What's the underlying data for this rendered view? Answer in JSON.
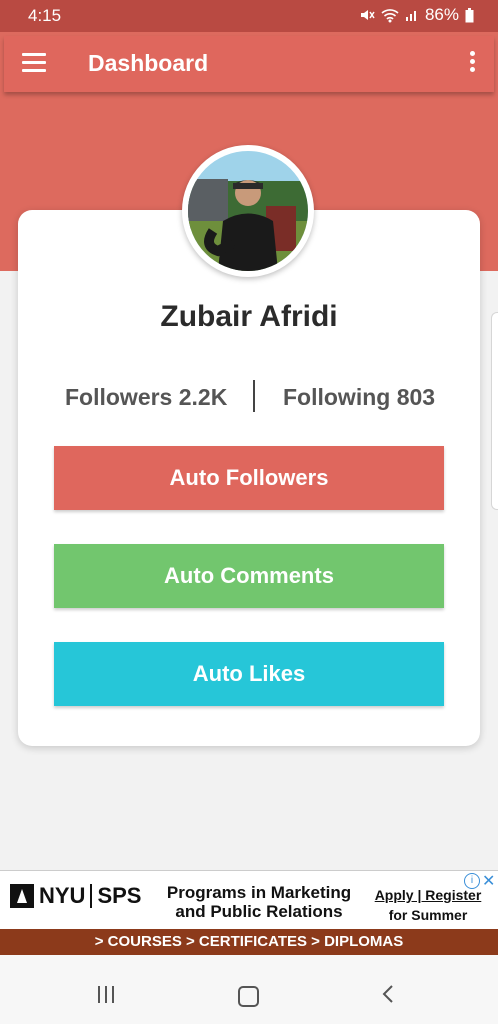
{
  "status_bar": {
    "time": "4:15",
    "battery": "86%"
  },
  "app_bar": {
    "title": "Dashboard",
    "menu_icon": "hamburger-menu-icon",
    "overflow_icon": "more-vert-icon"
  },
  "profile": {
    "name": "Zubair Afridi",
    "followers": "Followers 2.2K",
    "following": "Following 803"
  },
  "actions": [
    {
      "label": "Auto Followers",
      "color": "#df675d"
    },
    {
      "label": "Auto Comments",
      "color": "#72c66e"
    },
    {
      "label": "Auto Likes",
      "color": "#26c6d8"
    }
  ],
  "ad": {
    "brand_nyu": "NYU",
    "brand_sps": "SPS",
    "headline_line1": "Programs in Marketing",
    "headline_line2": "and Public Relations",
    "cta_line1": "Apply | Register",
    "cta_line2": "for Summer",
    "strip": "> COURSES > CERTIFICATES > DIPLOMAS"
  },
  "colors": {
    "primary": "#df675d",
    "status_bar": "#b94a42",
    "ad_strip": "#8c3a1b"
  }
}
